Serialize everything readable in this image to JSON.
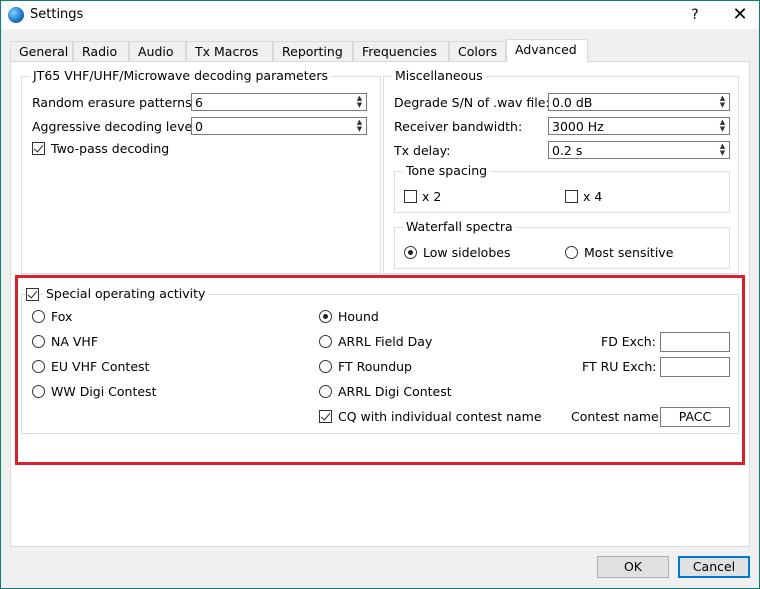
{
  "window": {
    "title": "Settings",
    "help_label": "?",
    "close_label": "✕"
  },
  "tabs": [
    "General",
    "Radio",
    "Audio",
    "Tx Macros",
    "Reporting",
    "Frequencies",
    "Colors",
    "Advanced"
  ],
  "jt65": {
    "title": "JT65 VHF/UHF/Microwave decoding parameters",
    "random_label": "Random erasure patterns:",
    "random_value": "6",
    "aggressive_label": "Aggressive decoding level:",
    "aggressive_value": "0",
    "twopass_label": "Two-pass decoding",
    "twopass_checked": true
  },
  "misc": {
    "title": "Miscellaneous",
    "degrade_label": "Degrade S/N of .wav file:",
    "degrade_value": "0.0 dB",
    "bandwidth_label": "Receiver bandwidth:",
    "bandwidth_value": "3000  Hz",
    "txdelay_label": "Tx delay:",
    "txdelay_value": "0.2  s"
  },
  "tone_spacing": {
    "title": "Tone spacing",
    "x2_label": "x 2",
    "x4_label": "x 4"
  },
  "waterfall": {
    "title": "Waterfall spectra",
    "low_label": "Low sidelobes",
    "most_label": "Most sensitive",
    "selected": "low"
  },
  "special": {
    "title": "Special operating activity",
    "enabled": true,
    "fox": "Fox",
    "na_vhf": "NA VHF",
    "eu_vhf": "EU VHF Contest",
    "ww_digi": "WW Digi Contest",
    "hound": "Hound",
    "arrl_field": "ARRL Field Day",
    "ft_roundup": "FT Roundup",
    "arrl_digi": "ARRL Digi Contest",
    "cq_label": "CQ with individual contest name",
    "cq_checked": true,
    "fd_exch_label": "FD Exch:",
    "fd_exch_value": "",
    "ftru_exch_label": "FT RU Exch:",
    "ftru_exch_value": "",
    "contest_name_label": "Contest name:",
    "contest_name_value": "PACC",
    "selected": "hound"
  },
  "buttons": {
    "ok": "OK",
    "cancel": "Cancel"
  },
  "colors": {
    "accent_border": "#107c6b",
    "highlight": "#d9202b",
    "default_button": "#0078d7"
  }
}
